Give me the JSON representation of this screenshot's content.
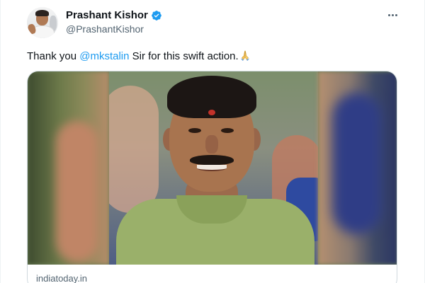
{
  "tweet": {
    "author": {
      "display_name": "Prashant Kishor",
      "handle": "@PrashantKishor",
      "verified": true,
      "verified_color": "#1d9bf0",
      "avatar_icon": "profile-photo"
    },
    "more_icon": "more-options-icon",
    "text_before": "Thank you ",
    "mention": "@mkstalin",
    "text_after": " Sir for this swift action.",
    "emoji": "folded-hands",
    "link_card": {
      "domain": "indiatoday.in",
      "image": "photo of a smiling man with a red tilak, wearing a light green shirt"
    }
  },
  "colors": {
    "accent": "#1d9bf0",
    "text": "#0f1419",
    "secondary": "#536471",
    "border": "#cfd9de"
  }
}
